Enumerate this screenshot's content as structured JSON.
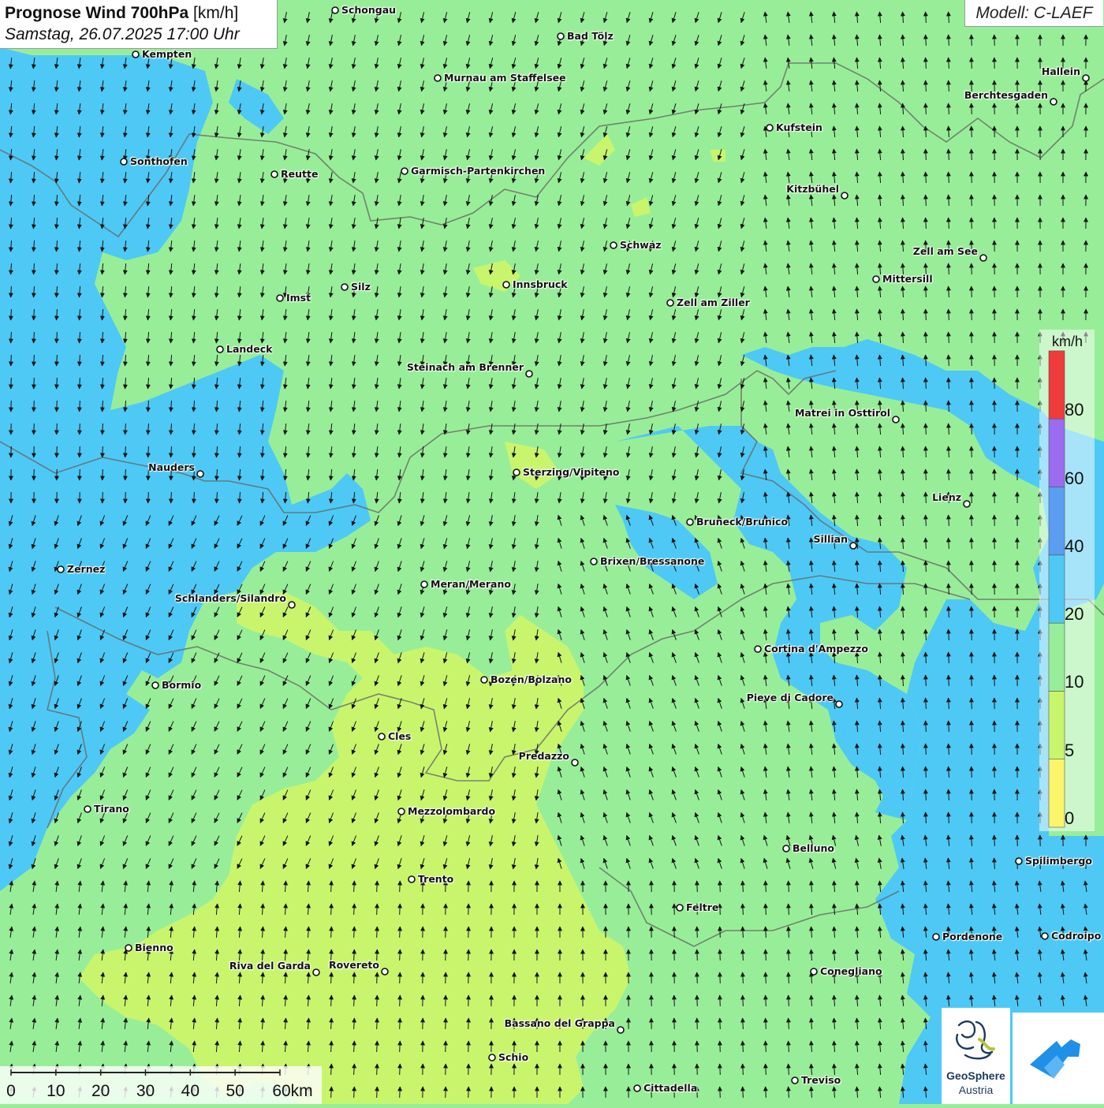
{
  "header": {
    "title_bold": "Prognose Wind 700hPa",
    "title_unit": "[km/h]",
    "datetime": "Samstag, 26.07.2025 17:00 Uhr"
  },
  "model": "Modell: C-LAEF",
  "legend": {
    "unit": "km/h",
    "ticks": [
      "0",
      "5",
      "10",
      "20",
      "40",
      "60",
      "80"
    ],
    "colors": [
      "#fbf56a",
      "#c9f56d",
      "#98ee98",
      "#4ec9f5",
      "#5b9df0",
      "#9b6cf0",
      "#ef3b3b"
    ]
  },
  "cities": [
    {
      "name": "Schongau",
      "side": "right"
    },
    {
      "name": "Bad Tölz",
      "side": "right"
    },
    {
      "name": "Kempten",
      "side": "right"
    },
    {
      "name": "Murnau am Staffelsee",
      "side": "right"
    },
    {
      "name": "Hallein",
      "side": "left"
    },
    {
      "name": "Berchtesgaden",
      "side": "left"
    },
    {
      "name": "Kufstein",
      "side": "right"
    },
    {
      "name": "Sonthofen",
      "side": "right"
    },
    {
      "name": "Reutte",
      "side": "right"
    },
    {
      "name": "Garmisch-Partenkirchen",
      "side": "right"
    },
    {
      "name": "Kitzbühel",
      "side": "left"
    },
    {
      "name": "Schwaz",
      "side": "right"
    },
    {
      "name": "Zell am See",
      "side": "left"
    },
    {
      "name": "Mittersill",
      "side": "right"
    },
    {
      "name": "Innsbruck",
      "side": "right"
    },
    {
      "name": "Silz",
      "side": "right"
    },
    {
      "name": "Imst",
      "side": "right"
    },
    {
      "name": "Zell am Ziller",
      "side": "right"
    },
    {
      "name": "Landeck",
      "side": "right"
    },
    {
      "name": "Steinach am Brenner",
      "side": "left"
    },
    {
      "name": "Matrei in Osttirol",
      "side": "left"
    },
    {
      "name": "Sterzing/Vipiteno",
      "side": "right"
    },
    {
      "name": "Nauders",
      "side": "left"
    },
    {
      "name": "Lienz",
      "side": "left"
    },
    {
      "name": "Bruneck/Brunico",
      "side": "right"
    },
    {
      "name": "Sillian",
      "side": "left"
    },
    {
      "name": "Brixen/Bressanone",
      "side": "right"
    },
    {
      "name": "Zernez",
      "side": "right"
    },
    {
      "name": "Meran/Merano",
      "side": "right"
    },
    {
      "name": "Schlanders/Silandro",
      "side": "left"
    },
    {
      "name": "Cortina d'Ampezzo",
      "side": "right"
    },
    {
      "name": "Bozen/Bolzano",
      "side": "right"
    },
    {
      "name": "Bormio",
      "side": "right"
    },
    {
      "name": "Pieve di Cadore",
      "side": "left"
    },
    {
      "name": "Cles",
      "side": "right"
    },
    {
      "name": "Predazzo",
      "side": "left"
    },
    {
      "name": "Tirano",
      "side": "right"
    },
    {
      "name": "Mezzolombardo",
      "side": "right"
    },
    {
      "name": "Belluno",
      "side": "right"
    },
    {
      "name": "Spilimbergo",
      "side": "right"
    },
    {
      "name": "Trento",
      "side": "right"
    },
    {
      "name": "Feltre",
      "side": "right"
    },
    {
      "name": "Pordenone",
      "side": "right"
    },
    {
      "name": "Codroipo",
      "side": "right"
    },
    {
      "name": "Bienno",
      "side": "right"
    },
    {
      "name": "Riva del Garda",
      "side": "left"
    },
    {
      "name": "Rovereto",
      "side": "left"
    },
    {
      "name": "Conegliano",
      "side": "right"
    },
    {
      "name": "Bassano del Grappa",
      "side": "left"
    },
    {
      "name": "Schio",
      "side": "right"
    },
    {
      "name": "Treviso",
      "side": "right"
    },
    {
      "name": "Cittadella",
      "side": "right"
    }
  ],
  "scale": {
    "labels": [
      "0",
      "10",
      "20",
      "30",
      "40",
      "50",
      "60km"
    ]
  },
  "logos": {
    "geosphere_name": "GeoSphere",
    "geosphere_sub": "Austria"
  }
}
